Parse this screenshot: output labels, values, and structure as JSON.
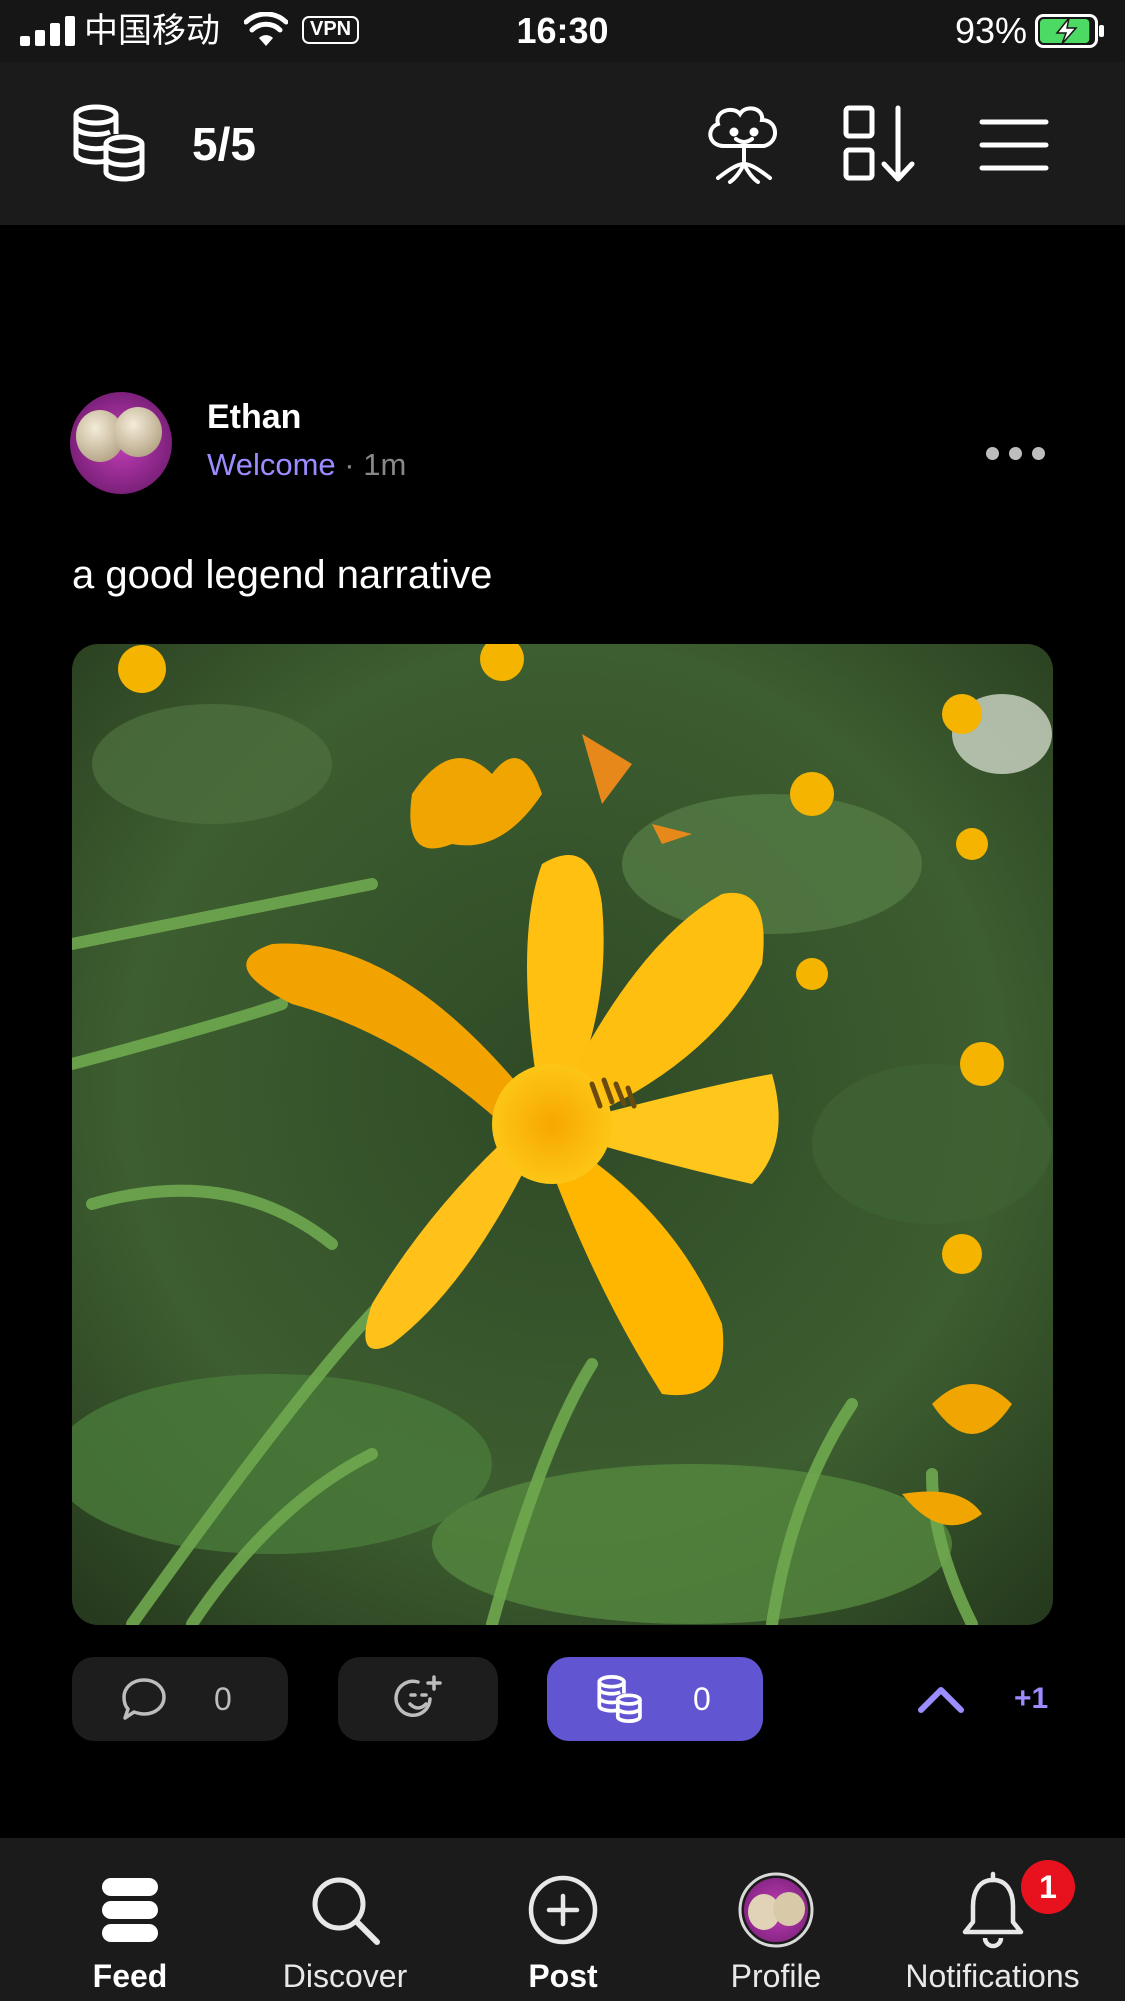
{
  "status_bar": {
    "carrier": "中国移动",
    "vpn_label": "VPN",
    "time": "16:30",
    "battery_percent": "93%",
    "battery_level": 0.93,
    "icons": [
      "signal-icon",
      "wifi-icon",
      "battery-charging-icon"
    ]
  },
  "header": {
    "quota": "5/5",
    "icons": [
      "coins-icon",
      "mascot-icon",
      "sort-icon",
      "menu-icon"
    ]
  },
  "post": {
    "author": "Ethan",
    "channel": "Welcome",
    "separator": "·",
    "time_ago": "1m",
    "text": "a good legend narrative",
    "image_subject": "yellow-daylily-photo",
    "actions": {
      "comment_count": "0",
      "tip_count": "0",
      "vote_delta": "+1"
    },
    "colors": {
      "accent": "#9b8cff",
      "tip_button": "#6155d2"
    }
  },
  "tabbar": {
    "tabs": [
      {
        "label": "Feed",
        "icon": "feed-icon"
      },
      {
        "label": "Discover",
        "icon": "search-icon"
      },
      {
        "label": "Post",
        "icon": "add-post-icon"
      },
      {
        "label": "Profile",
        "icon": "avatar"
      },
      {
        "label": "Notifications",
        "icon": "bell-icon"
      }
    ],
    "notification_badge": "1"
  }
}
